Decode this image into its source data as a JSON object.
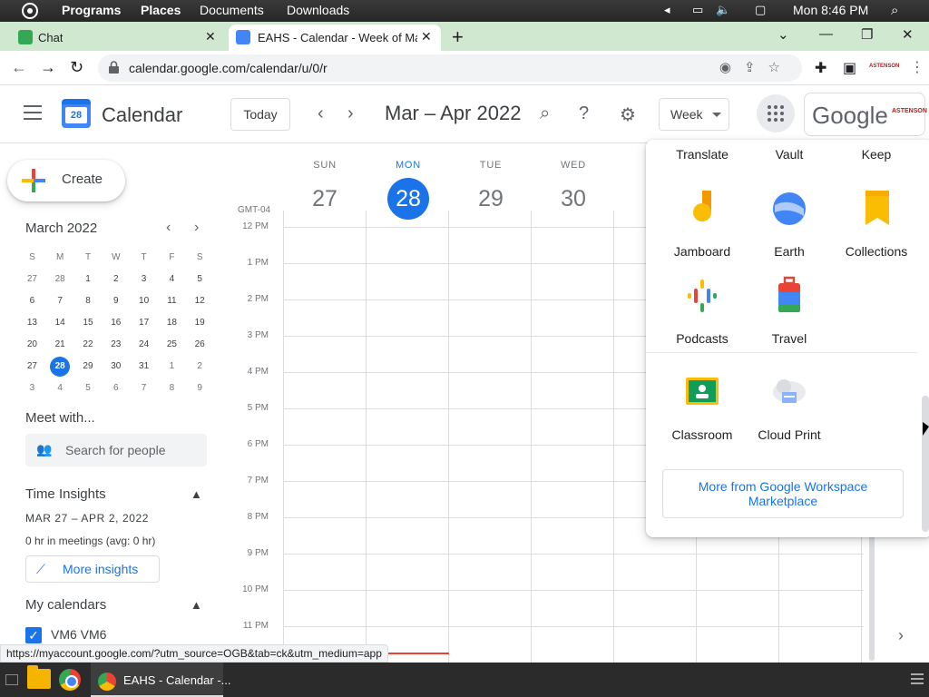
{
  "os_bar": {
    "menu": [
      "Programs",
      "Places",
      "Documents",
      "Downloads"
    ],
    "clock": "Mon 8:46 PM"
  },
  "tabs": [
    {
      "title": "Chat"
    },
    {
      "title": "EAHS - Calendar - Week of Marc"
    }
  ],
  "address_bar": {
    "url": "calendar.google.com/calendar/u/0/r"
  },
  "profile_badge": "ASTENSON",
  "header": {
    "app_title": "Calendar",
    "logo_day": "28",
    "today_label": "Today",
    "period": "Mar – Apr 2022",
    "view": "Week",
    "google_text": "Google",
    "account_badge": "ASTENSON"
  },
  "sidebar": {
    "create_label": "Create",
    "mini_month": "March 2022",
    "weekdays": [
      "S",
      "M",
      "T",
      "W",
      "T",
      "F",
      "S"
    ],
    "weeks": [
      [
        "27",
        "28",
        "1",
        "2",
        "3",
        "4",
        "5"
      ],
      [
        "6",
        "7",
        "8",
        "9",
        "10",
        "11",
        "12"
      ],
      [
        "13",
        "14",
        "15",
        "16",
        "17",
        "18",
        "19"
      ],
      [
        "20",
        "21",
        "22",
        "23",
        "24",
        "25",
        "26"
      ],
      [
        "27",
        "28",
        "29",
        "30",
        "31",
        "1",
        "2"
      ],
      [
        "3",
        "4",
        "5",
        "6",
        "7",
        "8",
        "9"
      ]
    ],
    "selected_day": "28",
    "meet_title": "Meet with...",
    "people_placeholder": "Search for people",
    "insights_title": "Time Insights",
    "insights_range": "MAR 27 – APR 2, 2022",
    "insights_meetings": "0 hr in meetings (avg: 0 hr)",
    "more_insights": "More insights",
    "my_calendars_title": "My calendars",
    "calendars": [
      {
        "name": "VM6 VM6",
        "color": "#1a73e8"
      }
    ]
  },
  "week": {
    "days": [
      {
        "dow": "SUN",
        "num": "27"
      },
      {
        "dow": "MON",
        "num": "28",
        "today": true
      },
      {
        "dow": "TUE",
        "num": "29"
      },
      {
        "dow": "WED",
        "num": "30"
      }
    ],
    "timezone": "GMT-04",
    "hours": [
      "12 PM",
      "1 PM",
      "2 PM",
      "3 PM",
      "4 PM",
      "5 PM",
      "6 PM",
      "7 PM",
      "8 PM",
      "9 PM",
      "10 PM",
      "11 PM"
    ]
  },
  "apps_popup": {
    "top_row": [
      "Translate",
      "Vault",
      "Keep"
    ],
    "apps": [
      {
        "label": "Jamboard",
        "icon": "jamboard-icon"
      },
      {
        "label": "Earth",
        "icon": "earth-icon"
      },
      {
        "label": "Collections",
        "icon": "collections-icon"
      },
      {
        "label": "Podcasts",
        "icon": "podcasts-icon"
      },
      {
        "label": "Travel",
        "icon": "travel-icon"
      },
      {
        "label": "Classroom",
        "icon": "classroom-icon"
      },
      {
        "label": "Cloud Print",
        "icon": "cloud-print-icon"
      }
    ],
    "more_button": "More from Google Workspace Marketplace"
  },
  "status_url": "https://myaccount.google.com/?utm_source=OGB&tab=ck&utm_medium=app",
  "taskbar": {
    "window_title": "EAHS - Calendar -..."
  },
  "colors": {
    "accent": "#1a73e8",
    "now_line": "#ea4335",
    "tab_strip": "#cfe8cf"
  }
}
